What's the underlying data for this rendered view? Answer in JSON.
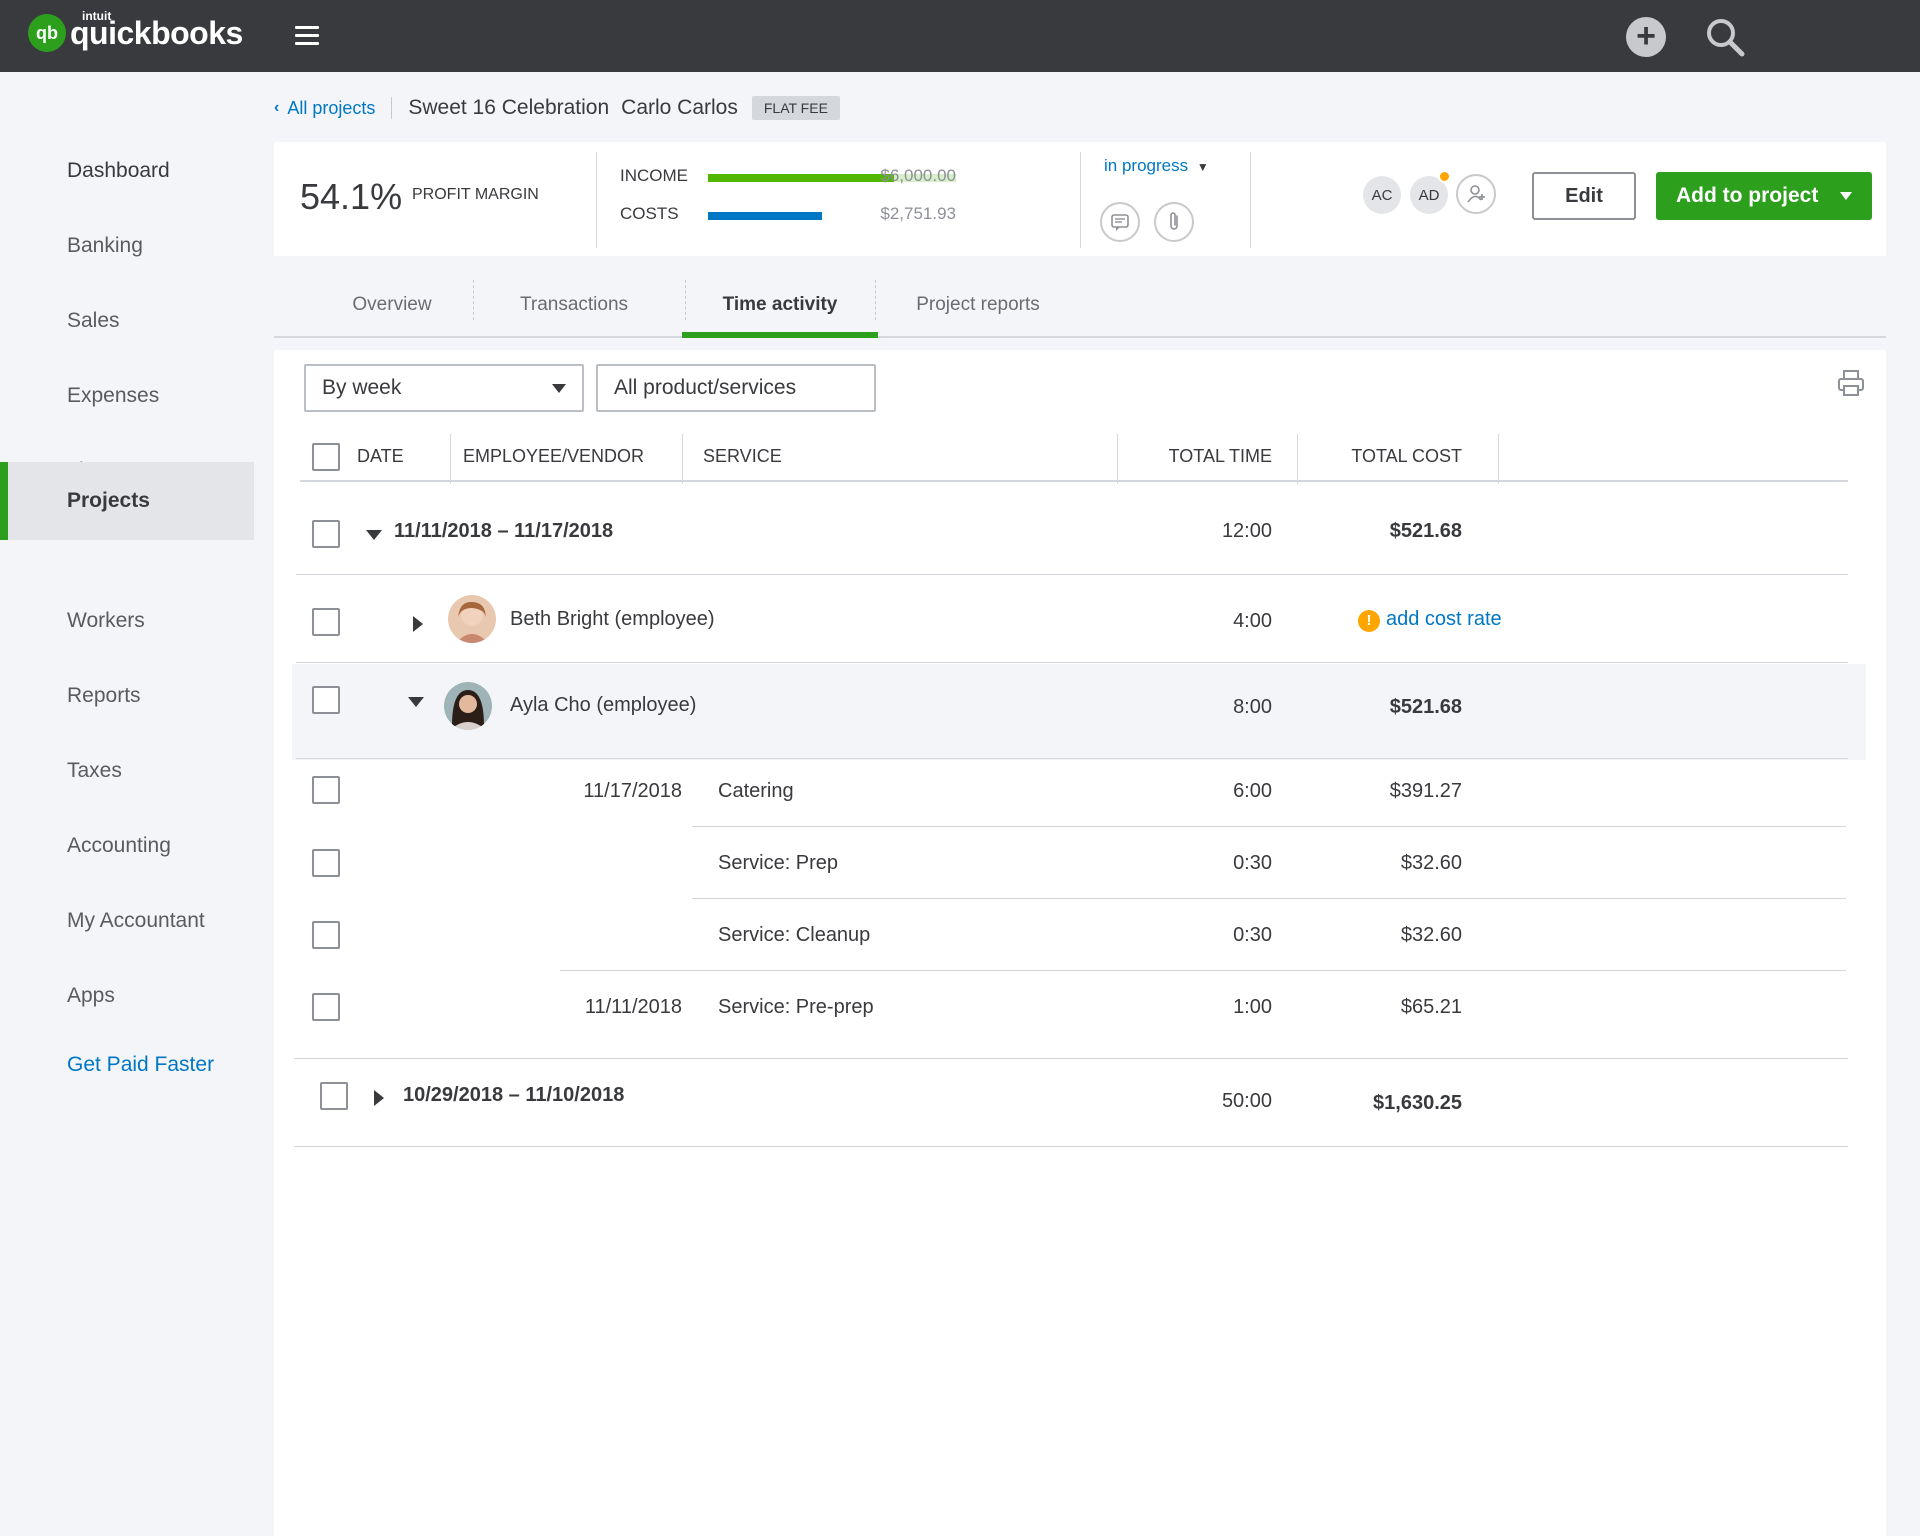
{
  "app": {
    "brand_small": "intuit",
    "brand": "quickbooks"
  },
  "topbar": {
    "menu_icon": "hamburger-icon",
    "create_icon": "plus-icon",
    "search_icon": "search-icon"
  },
  "sidebar": {
    "items": [
      {
        "label": "Dashboard"
      },
      {
        "label": "Banking"
      },
      {
        "label": "Sales"
      },
      {
        "label": "Expenses"
      },
      {
        "label": "Time"
      },
      {
        "label": "Projects",
        "active": true
      },
      {
        "label": "Workers"
      },
      {
        "label": "Reports"
      },
      {
        "label": "Taxes"
      },
      {
        "label": "Accounting"
      },
      {
        "label": "My Accountant"
      },
      {
        "label": "Apps"
      }
    ],
    "cta": "Get Paid Faster"
  },
  "breadcrumb": {
    "back": "All projects",
    "title": "Sweet 16 Celebration",
    "client": "Carlo Carlos",
    "badge": "FLAT FEE"
  },
  "summary": {
    "profit_margin_value": "54.1%",
    "profit_margin_label": "PROFIT MARGIN",
    "income_label": "INCOME",
    "income_amount": "$6,000.00",
    "income_fraction": 0.75,
    "costs_label": "COSTS",
    "costs_amount": "$2,751.93",
    "costs_fraction": 0.46,
    "status": "in progress",
    "team": [
      "AC",
      "AD"
    ],
    "edit": "Edit",
    "add": "Add to project"
  },
  "tabs": [
    {
      "label": "Overview"
    },
    {
      "label": "Transactions"
    },
    {
      "label": "Time activity",
      "active": true
    },
    {
      "label": "Project reports"
    }
  ],
  "filters": {
    "period": "By week",
    "products": "All product/services"
  },
  "table": {
    "headers": {
      "date": "DATE",
      "employee": "EMPLOYEE/VENDOR",
      "service": "SERVICE",
      "total_time": "TOTAL TIME",
      "total_cost": "TOTAL COST"
    },
    "week1": {
      "range": "11/11/2018 – 11/17/2018",
      "time": "12:00",
      "cost": "$521.68"
    },
    "beth": {
      "name": "Beth Bright (employee)",
      "time": "4:00",
      "cost_link": "add cost rate"
    },
    "ayla": {
      "name": "Ayla Cho (employee)",
      "time": "8:00",
      "cost": "$521.68"
    },
    "entries": [
      {
        "date": "11/17/2018",
        "service": "Catering",
        "time": "6:00",
        "cost": "$391.27"
      },
      {
        "date": "",
        "service": "Service: Prep",
        "time": "0:30",
        "cost": "$32.60"
      },
      {
        "date": "",
        "service": "Service: Cleanup",
        "time": "0:30",
        "cost": "$32.60"
      },
      {
        "date": "11/11/2018",
        "service": "Service: Pre-prep",
        "time": "1:00",
        "cost": "$65.21"
      }
    ],
    "week2": {
      "range": "10/29/2018 – 11/10/2018",
      "time": "50:00",
      "cost": "$1,630.25"
    }
  },
  "colors": {
    "brand_green": "#2ca01c",
    "link_blue": "#0077c5",
    "income_bar": "#53b700",
    "cost_bar": "#0077c5",
    "warning": "#ffa500"
  }
}
